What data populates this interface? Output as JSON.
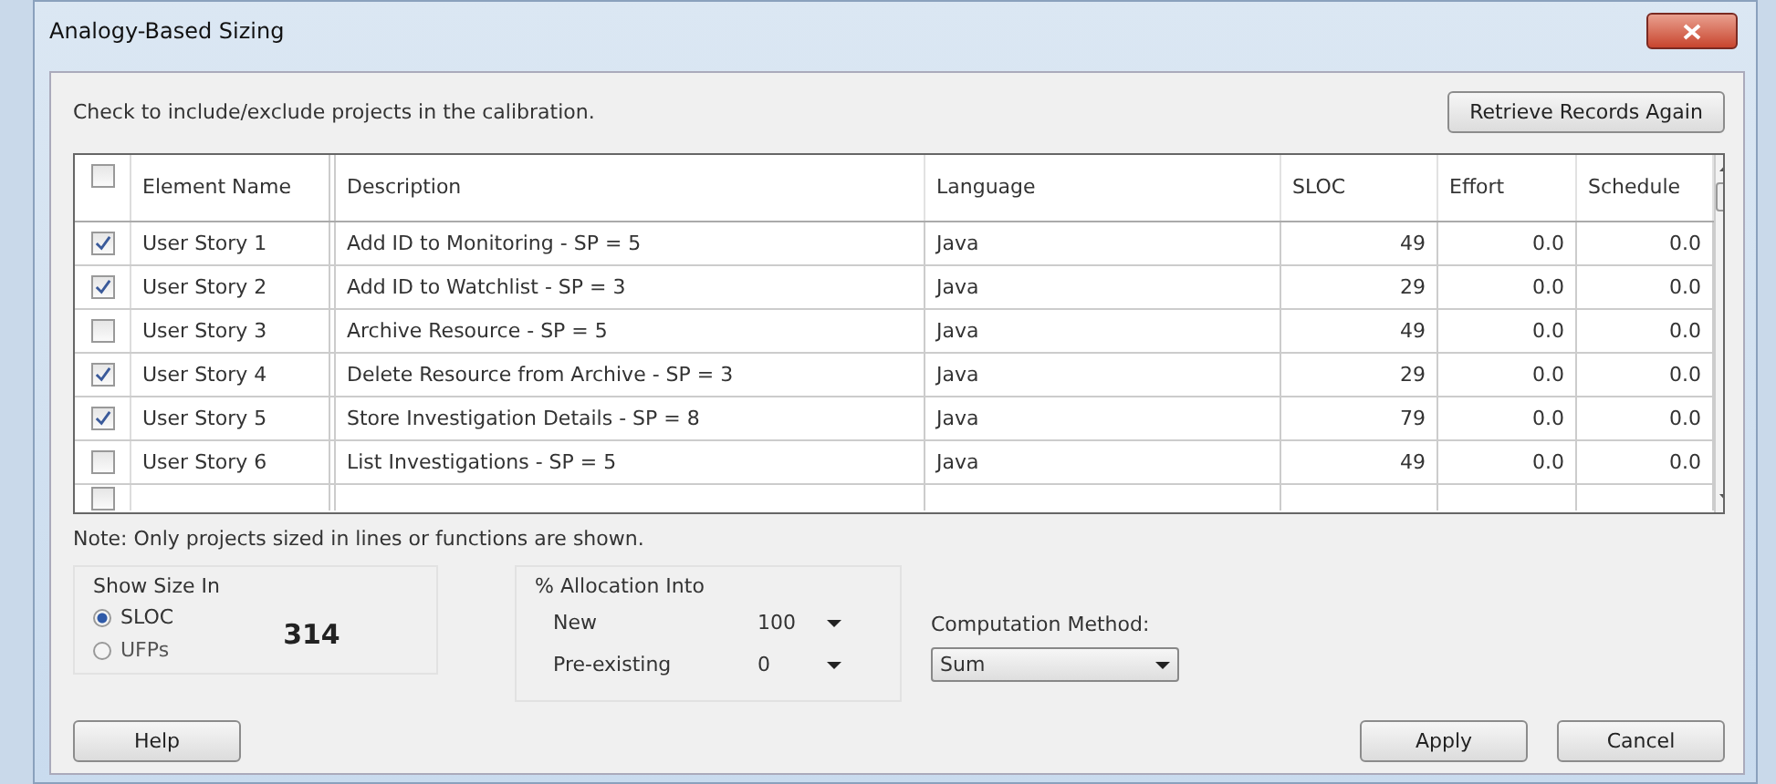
{
  "window": {
    "title": "Analogy-Based Sizing"
  },
  "instruction": "Check to include/exclude projects in the calibration.",
  "retrieve_button": "Retrieve Records Again",
  "table": {
    "all_checked": false,
    "columns": [
      "Element Name",
      "Description",
      "Language",
      "SLOC",
      "Effort",
      "Schedule"
    ],
    "rows": [
      {
        "checked": true,
        "cells": [
          "User Story 1",
          "Add ID  to Monitoring - SP = 5",
          "Java",
          "49",
          "0.0",
          "0.0"
        ]
      },
      {
        "checked": true,
        "cells": [
          "User Story 2",
          "Add ID  to Watchlist - SP = 3",
          "Java",
          "29",
          "0.0",
          "0.0"
        ]
      },
      {
        "checked": false,
        "cells": [
          "User Story 3",
          "Archive Resource - SP = 5",
          "Java",
          "49",
          "0.0",
          "0.0"
        ]
      },
      {
        "checked": true,
        "cells": [
          "User Story 4",
          "Delete Resource from Archive - SP = 3",
          "Java",
          "29",
          "0.0",
          "0.0"
        ]
      },
      {
        "checked": true,
        "cells": [
          "User Story 5",
          "Store Investigation Details - SP = 8",
          "Java",
          "79",
          "0.0",
          "0.0"
        ]
      },
      {
        "checked": false,
        "cells": [
          "User Story 6",
          "List Investigations - SP = 5",
          "Java",
          "49",
          "0.0",
          "0.0"
        ]
      }
    ],
    "partial_row": {
      "checked": false
    }
  },
  "note": "Note: Only projects sized in lines or functions are shown.",
  "show_size_in": {
    "label": "Show Size In",
    "options": [
      {
        "label": "SLOC",
        "selected": true
      },
      {
        "label": "UFPs",
        "selected": false
      }
    ],
    "total": "314"
  },
  "allocation": {
    "label": "% Allocation Into",
    "fields": [
      {
        "label": "New",
        "value": "100"
      },
      {
        "label": "Pre-existing",
        "value": "0"
      }
    ]
  },
  "computation": {
    "label": "Computation Method:",
    "value": "Sum"
  },
  "buttons": {
    "help": "Help",
    "apply": "Apply",
    "cancel": "Cancel"
  }
}
